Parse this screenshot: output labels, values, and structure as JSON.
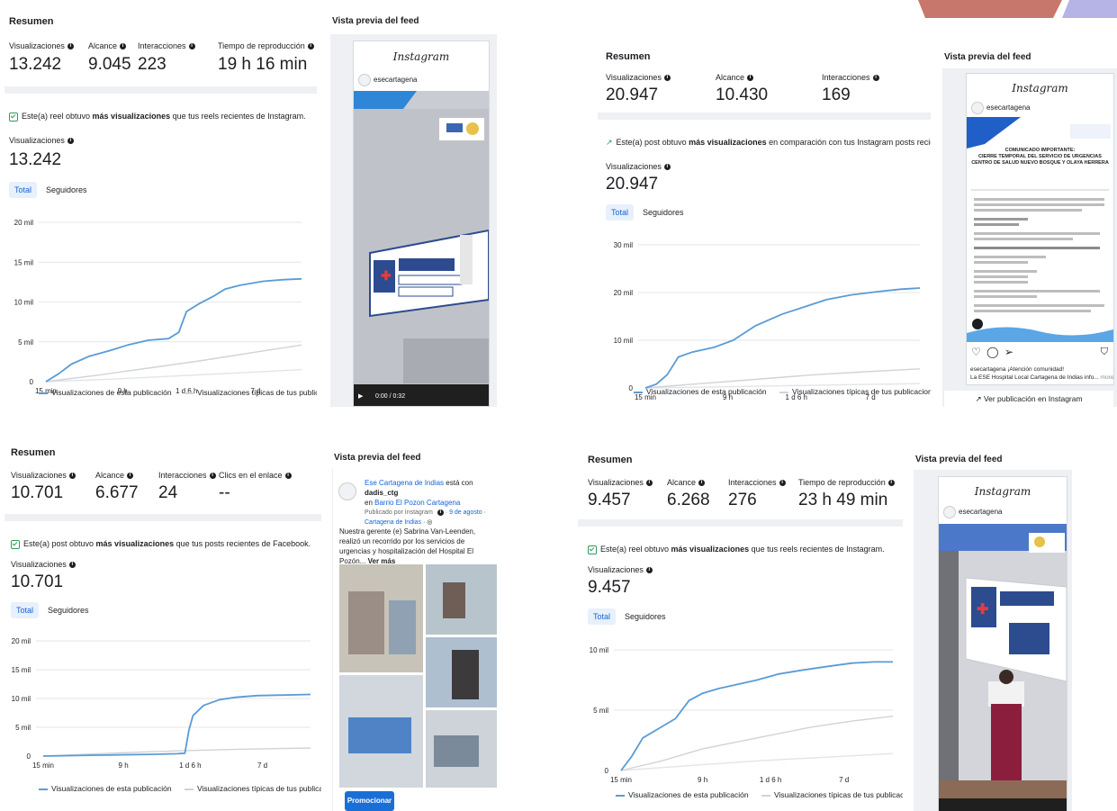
{
  "labels": {
    "summary": "Resumen",
    "views": "Visualizaciones",
    "reach": "Alcance",
    "interactions": "Interacciones",
    "playtime": "Tiempo de reproducción",
    "link_clicks": "Clics en el enlace",
    "feed_preview": "Vista previa del feed",
    "tab_total": "Total",
    "tab_followers": "Seguidores",
    "legend_this": "Visualizaciones de esta publicación",
    "legend_typical": "Visualizaciones típicas de tus publicaciones",
    "instagram": "Instagram",
    "account": "esecartagena"
  },
  "panels": [
    {
      "id": "reel-1",
      "metrics": {
        "views": "13.242",
        "reach": "9.045",
        "interactions": "223",
        "playtime": "19 h 16 min"
      },
      "insight_pre": "Este(a) reel obtuvo ",
      "insight_bold": "más visualizaciones",
      "insight_post": " que tus reels recientes de Instagram.",
      "chart_views": "13.242",
      "video_time": "0:00 / 0:32"
    },
    {
      "id": "post-1",
      "metrics": {
        "views": "20.947",
        "reach": "10.430",
        "interactions": "169"
      },
      "insight_pre": "Este(a) post obtuvo ",
      "insight_bold": "más visualizaciones",
      "insight_post": " en comparación con tus Instagram posts recientes.",
      "chart_views": "20.947",
      "post_heading_1": "COMUNICADO IMPORTANTE:",
      "post_heading_2": "CIERRE TEMPORAL DEL SERVICIO DE URGENCIAS",
      "post_heading_3": "CENTRO DE SALUD NUEVO BOSQUE Y OLAYA HERRERA",
      "caption_account": "esecartagena",
      "caption_text": "¡Atención comunidad!",
      "caption_line2": "La ESE Hospital Local Cartagena de Indias info...",
      "caption_more": "more",
      "view_on_ig": "Ver publicación en Instagram"
    },
    {
      "id": "fb-post",
      "metrics": {
        "views": "10.701",
        "reach": "6.677",
        "interactions": "24",
        "link_clicks": "--"
      },
      "insight_pre": "Este(a) post obtuvo ",
      "insight_bold": "más visualizaciones",
      "insight_post": " que tus posts recientes de Facebook.",
      "chart_views": "10.701",
      "fb_page": "Ese Cartagena de Indias",
      "fb_with_pre": " está con ",
      "fb_with": "dadis_ctg",
      "fb_in_pre": "en ",
      "fb_location": "Barrio El Pozon Cartagena",
      "fb_published": "Publicado por Instagram",
      "fb_date": "9 de agosto",
      "fb_city": "Cartagena de Indias",
      "fb_text": "Nuestra gerente (e) Sabrina Van-Leenden, realizó un recorrido por los servicios de urgencias y hospitalización del Hospital El Pozón...",
      "fb_more": "Ver más",
      "promote": "Promocionar"
    },
    {
      "id": "reel-2",
      "metrics": {
        "views": "9.457",
        "reach": "6.268",
        "interactions": "276",
        "playtime": "23 h 49 min"
      },
      "insight_pre": "Este(a) reel obtuvo ",
      "insight_bold": "más visualizaciones",
      "insight_post": " que tus reels recientes de Instagram.",
      "chart_views": "9.457"
    }
  ],
  "chart_data": [
    {
      "type": "line",
      "x_ticks": [
        "15 min",
        "9 h",
        "1 d 6 h",
        "7 d"
      ],
      "y_ticks": [
        "0",
        "5 mil",
        "10 mil",
        "15 mil",
        "20 mil"
      ],
      "ylim": [
        0,
        20000
      ],
      "series": [
        {
          "name": "Visualizaciones de esta publicación",
          "x": [
            0,
            0.05,
            0.1,
            0.17,
            0.25,
            0.32,
            0.4,
            0.48,
            0.52,
            0.55,
            0.6,
            0.66,
            0.7,
            0.76,
            0.85,
            0.93,
            1.0
          ],
          "y": [
            0,
            1000,
            2200,
            3200,
            3900,
            4600,
            5200,
            5400,
            6200,
            8800,
            9800,
            10800,
            11600,
            12100,
            12600,
            12800,
            12900
          ]
        },
        {
          "name": "Visualizaciones típicas de tus publicaciones",
          "x": [
            0,
            0.2,
            0.4,
            0.6,
            0.8,
            1.0
          ],
          "y": [
            0,
            800,
            1700,
            2600,
            3600,
            4600
          ]
        },
        {
          "name": "Visualizaciones típicas de tus publicaciones",
          "x": [
            0,
            0.25,
            0.5,
            0.75,
            1.0
          ],
          "y": [
            0,
            300,
            700,
            1100,
            1500
          ]
        }
      ]
    },
    {
      "type": "line",
      "x_ticks": [
        "15 min",
        "9 h",
        "1 d 6 h",
        "7 d"
      ],
      "y_ticks": [
        "0",
        "10 mil",
        "20 mil",
        "30 mil"
      ],
      "ylim": [
        0,
        30000
      ],
      "series": [
        {
          "name": "Visualizaciones de esta publicación",
          "x": [
            0,
            0.04,
            0.08,
            0.12,
            0.17,
            0.25,
            0.32,
            0.4,
            0.5,
            0.58,
            0.66,
            0.75,
            0.85,
            0.93,
            1.0
          ],
          "y": [
            0,
            800,
            2800,
            6500,
            7500,
            8500,
            10000,
            13000,
            15500,
            17000,
            18500,
            19500,
            20200,
            20700,
            20947
          ]
        },
        {
          "name": "Visualizaciones típicas de tus publicaciones",
          "x": [
            0,
            0.2,
            0.4,
            0.6,
            0.8,
            1.0
          ],
          "y": [
            0,
            900,
            1800,
            2700,
            3400,
            4000
          ]
        },
        {
          "name": "Visualizaciones típicas de tus publicaciones",
          "x": [
            0,
            0.25,
            0.5,
            0.75,
            1.0
          ],
          "y": [
            0,
            200,
            450,
            700,
            900
          ]
        }
      ]
    },
    {
      "type": "line",
      "x_ticks": [
        "15 min",
        "9 h",
        "1 d 6 h",
        "7 d"
      ],
      "y_ticks": [
        "0",
        "5 mil",
        "10 mil",
        "15 mil",
        "20 mil"
      ],
      "ylim": [
        0,
        20000
      ],
      "series": [
        {
          "name": "Visualizaciones de esta publicación",
          "x": [
            0,
            0.2,
            0.4,
            0.5,
            0.53,
            0.545,
            0.56,
            0.6,
            0.66,
            0.72,
            0.8,
            0.9,
            1.0
          ],
          "y": [
            0,
            150,
            300,
            400,
            500,
            4500,
            7000,
            8800,
            9800,
            10200,
            10500,
            10600,
            10701
          ]
        },
        {
          "name": "Visualizaciones típicas de tus publicaciones",
          "x": [
            0,
            0.25,
            0.5,
            0.75,
            1.0
          ],
          "y": [
            0,
            500,
            900,
            1200,
            1400
          ]
        }
      ]
    },
    {
      "type": "line",
      "x_ticks": [
        "15 min",
        "9 h",
        "1 d 6 h",
        "7 d"
      ],
      "y_ticks": [
        "0",
        "5 mil",
        "10 mil"
      ],
      "ylim": [
        0,
        10000
      ],
      "series": [
        {
          "name": "Visualizaciones de esta publicación",
          "x": [
            0,
            0.04,
            0.08,
            0.14,
            0.2,
            0.25,
            0.3,
            0.36,
            0.42,
            0.5,
            0.58,
            0.66,
            0.75,
            0.85,
            0.93,
            1.0
          ],
          "y": [
            0,
            1200,
            2700,
            3500,
            4300,
            5800,
            6400,
            6800,
            7100,
            7500,
            8000,
            8300,
            8600,
            8900,
            9000,
            9000
          ]
        },
        {
          "name": "Visualizaciones típicas de tus publicaciones",
          "x": [
            0,
            0.15,
            0.3,
            0.5,
            0.7,
            0.85,
            1.0
          ],
          "y": [
            0,
            800,
            1800,
            2700,
            3600,
            4100,
            4500
          ]
        },
        {
          "name": "Visualizaciones típicas de tus publicaciones",
          "x": [
            0,
            0.25,
            0.5,
            0.75,
            1.0
          ],
          "y": [
            0,
            400,
            800,
            1100,
            1400
          ]
        }
      ]
    }
  ],
  "colors": {
    "primary_line": "#5b9bd5",
    "typical_line": "#d0d3d8",
    "typical_line_2": "#e2e4e8",
    "accent": "#1463d8",
    "panel_bg": "#eef0f3"
  }
}
